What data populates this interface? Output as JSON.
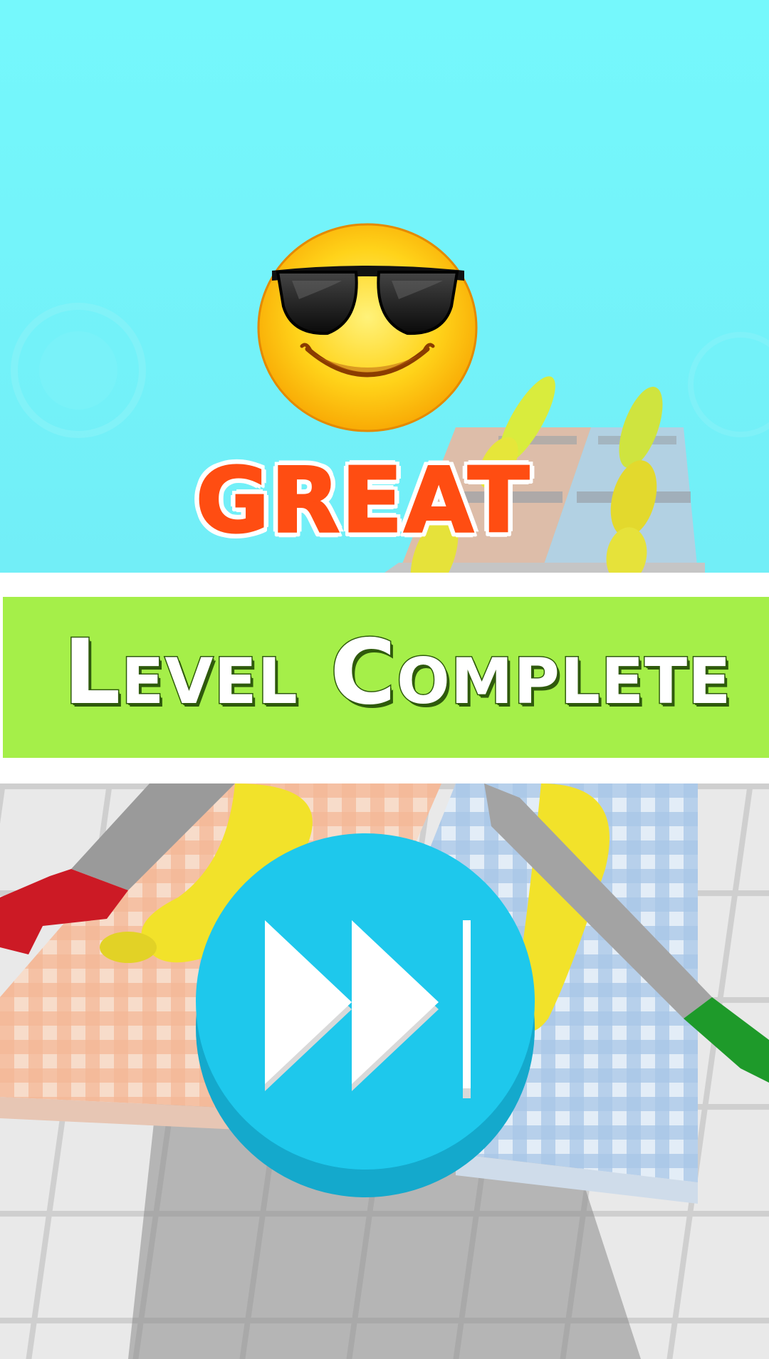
{
  "popup": {
    "rating_text": "GREAT",
    "banner_text": "Level Complete"
  },
  "icons": {
    "emoji": "sunglasses-smiley-icon",
    "next": "skip-forward-icon"
  },
  "colors": {
    "sky": "#75f8fc",
    "great_text": "#ff4d12",
    "banner_green": "#a5ef49",
    "banner_text_outline": "#2f5a0c",
    "next_button": "#1ec8ec",
    "next_button_shadow": "#14a9cc"
  }
}
